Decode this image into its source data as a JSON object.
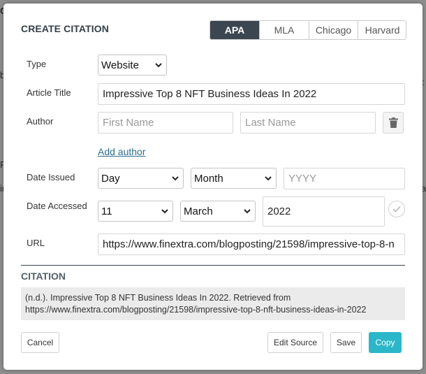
{
  "dialog": {
    "title": "CREATE CITATION",
    "styles": [
      {
        "label": "APA",
        "active": true
      },
      {
        "label": "MLA",
        "active": false
      },
      {
        "label": "Chicago",
        "active": false
      },
      {
        "label": "Harvard",
        "active": false
      }
    ]
  },
  "form": {
    "type": {
      "label": "Type",
      "value": "Website"
    },
    "article_title": {
      "label": "Article Title",
      "value": "Impressive Top 8 NFT Business Ideas In 2022"
    },
    "author": {
      "label": "Author",
      "first_name_placeholder": "First Name",
      "last_name_placeholder": "Last Name",
      "add_author": "Add author"
    },
    "date_issued": {
      "label": "Date Issued",
      "day": "Day",
      "month": "Month",
      "year_placeholder": "YYYY"
    },
    "date_accessed": {
      "label": "Date Accessed",
      "day": "11",
      "month": "March",
      "year": "2022"
    },
    "url": {
      "label": "URL",
      "value": "https://www.finextra.com/blogposting/21598/impressive-top-8-n"
    }
  },
  "citation": {
    "heading": "CITATION",
    "line1": "(n.d.). Impressive Top 8 NFT Business Ideas In 2022. Retrieved from",
    "line2": "https://www.finextra.com/blogposting/21598/impressive-top-8-nft-business-ideas-in-2022"
  },
  "buttons": {
    "cancel": "Cancel",
    "edit_source": "Edit Source",
    "save": "Save",
    "copy": "Copy"
  },
  "background_hints": [
    "C",
    "b",
    "F",
    "ir",
    "t",
    "a"
  ],
  "colors": {
    "accent": "#2ab7c9",
    "header_dark": "#3c4650",
    "link": "#2b6e8f"
  }
}
